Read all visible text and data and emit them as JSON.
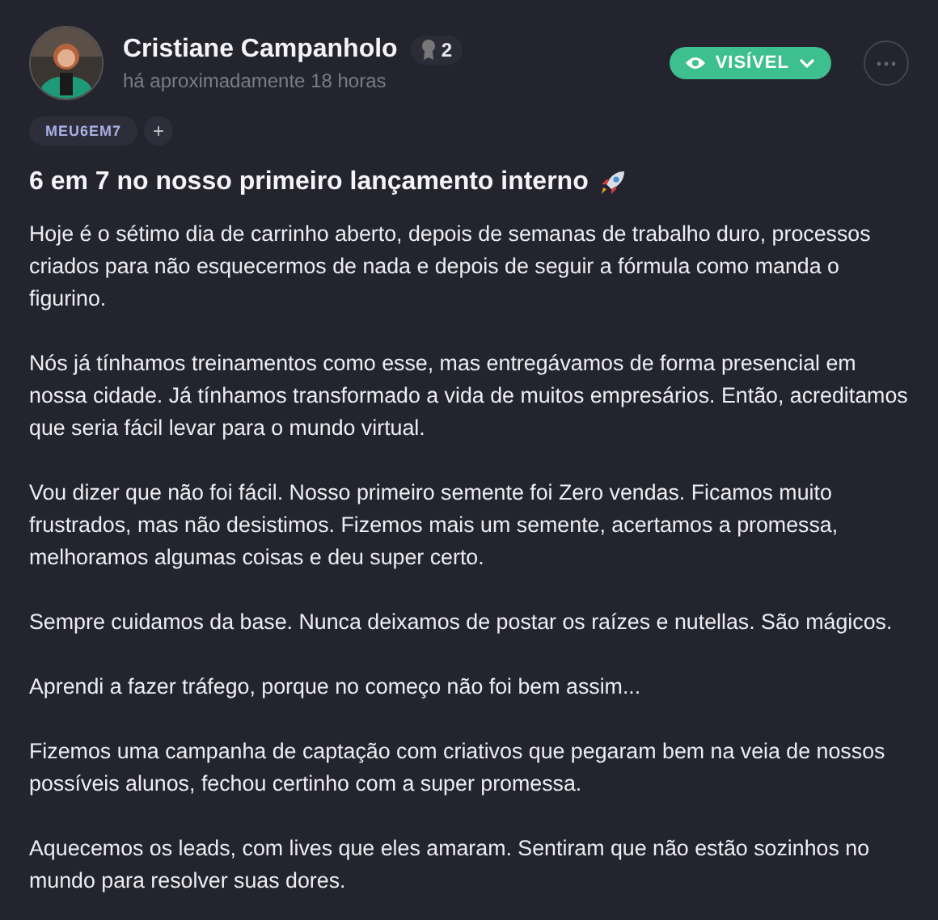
{
  "author": {
    "name": "Cristiane Campanholo",
    "badge_count": "2",
    "time": "há aproximadamente 18 horas"
  },
  "visibility": {
    "label": "VISÍVEL"
  },
  "tags": [
    "MEU6EM7"
  ],
  "add_tag": "+",
  "post": {
    "title": "6 em 7 no nosso primeiro lançamento interno",
    "paragraphs": [
      "Hoje é o sétimo dia de carrinho aberto, depois de semanas de trabalho duro, processos criados para não esquecermos de nada e depois de seguir a fórmula como manda o figurino.",
      "Nós já tínhamos treinamentos como esse, mas entregávamos de forma presencial em nossa cidade. Já tínhamos transformado a vida de muitos empresários. Então, acreditamos que seria fácil levar para o mundo virtual.",
      "Vou dizer que não foi fácil. Nosso primeiro semente foi Zero vendas. Ficamos muito frustrados, mas não desistimos. Fizemos mais um semente, acertamos a promessa, melhoramos algumas coisas e deu super certo.",
      "Sempre cuidamos da base. Nunca deixamos de postar os raízes e nutellas. São mágicos.",
      "Aprendi a fazer tráfego, porque no começo não foi bem assim...",
      "Fizemos uma campanha de captação com criativos que pegaram bem na veia de nossos possíveis alunos, fechou certinho com a super promessa.",
      "Aquecemos os leads, com lives que eles amaram. Sentiram que não estão sozinhos no mundo para resolver suas dores."
    ]
  }
}
